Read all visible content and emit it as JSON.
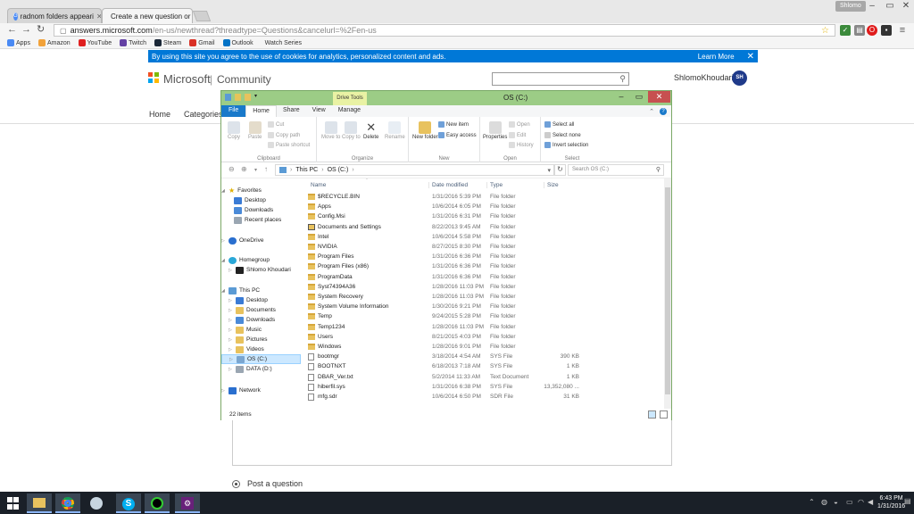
{
  "browser": {
    "tabs": [
      {
        "title": "radnom folders appeari",
        "active": false
      },
      {
        "title": "Create a new question or",
        "active": true
      }
    ],
    "profile": "Shlomo",
    "url_host": "answers.microsoft.com",
    "url_path": "/en-us/newthread?threadtype=Questions&cancelurl=%2Fen-us",
    "bookmarks": [
      "Apps",
      "Amazon",
      "YouTube",
      "Twitch",
      "Steam",
      "Gmail",
      "Outlook",
      "Watch Series"
    ]
  },
  "site": {
    "cookie_text": "By using this site you agree to the use of cookies for analytics, personalized content and ads.",
    "learn_more": "Learn More",
    "brand": "Microsoft",
    "separator": "|",
    "community": "Community",
    "user_name": "ShlomoKhoudari",
    "avatar_initials": "SH",
    "nav": [
      "Home",
      "Categories"
    ],
    "post_question": "Post a question"
  },
  "explorer": {
    "title": "OS (C:)",
    "context_tab": "Drive Tools",
    "tabs": [
      "File",
      "Home",
      "Share",
      "View",
      "Manage"
    ],
    "ribbon": {
      "clipboard": {
        "label": "Clipboard",
        "copy": "Copy",
        "paste": "Paste",
        "cut": "Cut",
        "copy_path": "Copy path",
        "paste_shortcut": "Paste shortcut"
      },
      "organize": {
        "label": "Organize",
        "move_to": "Move to",
        "copy_to": "Copy to",
        "delete": "Delete",
        "rename": "Rename"
      },
      "new": {
        "label": "New",
        "new_item": "New item",
        "easy_access": "Easy access",
        "new_folder": "New folder"
      },
      "open": {
        "label": "Open",
        "open": "Open",
        "edit": "Edit",
        "history": "History",
        "properties": "Properties"
      },
      "select": {
        "label": "Select",
        "all": "Select all",
        "none": "Select none",
        "invert": "Invert selection"
      }
    },
    "address": {
      "crumbs": [
        "This PC",
        "OS (C:)"
      ],
      "search_placeholder": "Search OS (C:)"
    },
    "nav": {
      "favorites": "Favorites",
      "desktop": "Desktop",
      "downloads": "Downloads",
      "recent": "Recent places",
      "onedrive": "OneDrive",
      "homegroup": "Homegroup",
      "hg_user": "Shlomo Khoudari",
      "thispc": "This PC",
      "pc_desktop": "Desktop",
      "pc_documents": "Documents",
      "pc_downloads": "Downloads",
      "pc_music": "Music",
      "pc_pictures": "Pictures",
      "pc_videos": "Videos",
      "pc_os": "OS (C:)",
      "pc_data": "DATA (D:)",
      "network": "Network"
    },
    "columns": {
      "name": "Name",
      "date": "Date modified",
      "type": "Type",
      "size": "Size"
    },
    "files": [
      {
        "name": "$RECYCLE.BIN",
        "date": "1/31/2016 5:39 PM",
        "type": "File folder",
        "size": "",
        "icon": "folder"
      },
      {
        "name": "Apps",
        "date": "10/6/2014 6:05 PM",
        "type": "File folder",
        "size": "",
        "icon": "folder"
      },
      {
        "name": "Config.Msi",
        "date": "1/31/2016 6:31 PM",
        "type": "File folder",
        "size": "",
        "icon": "folder"
      },
      {
        "name": "Documents and Settings",
        "date": "8/22/2013 9:45 AM",
        "type": "File folder",
        "size": "",
        "icon": "link"
      },
      {
        "name": "Intel",
        "date": "10/6/2014 5:58 PM",
        "type": "File folder",
        "size": "",
        "icon": "folder"
      },
      {
        "name": "NVIDIA",
        "date": "8/27/2015 8:30 PM",
        "type": "File folder",
        "size": "",
        "icon": "folder"
      },
      {
        "name": "Program Files",
        "date": "1/31/2016 6:36 PM",
        "type": "File folder",
        "size": "",
        "icon": "folder"
      },
      {
        "name": "Program Files (x86)",
        "date": "1/31/2016 6:36 PM",
        "type": "File folder",
        "size": "",
        "icon": "folder"
      },
      {
        "name": "ProgramData",
        "date": "1/31/2016 6:36 PM",
        "type": "File folder",
        "size": "",
        "icon": "folder"
      },
      {
        "name": "Syst74394A36",
        "date": "1/28/2016 11:03 PM",
        "type": "File folder",
        "size": "",
        "icon": "folder"
      },
      {
        "name": "System Recovery",
        "date": "1/28/2016 11:03 PM",
        "type": "File folder",
        "size": "",
        "icon": "folder"
      },
      {
        "name": "System Volume Information",
        "date": "1/30/2016 9:21 PM",
        "type": "File folder",
        "size": "",
        "icon": "folder"
      },
      {
        "name": "Temp",
        "date": "9/24/2015 5:28 PM",
        "type": "File folder",
        "size": "",
        "icon": "folder"
      },
      {
        "name": "Temp1234",
        "date": "1/28/2016 11:03 PM",
        "type": "File folder",
        "size": "",
        "icon": "folder"
      },
      {
        "name": "Users",
        "date": "8/21/2015 4:03 PM",
        "type": "File folder",
        "size": "",
        "icon": "folder"
      },
      {
        "name": "Windows",
        "date": "1/28/2016 9:01 PM",
        "type": "File folder",
        "size": "",
        "icon": "folder"
      },
      {
        "name": "bootmgr",
        "date": "3/18/2014 4:54 AM",
        "type": "SYS File",
        "size": "390 KB",
        "icon": "file"
      },
      {
        "name": "BOOTNXT",
        "date": "6/18/2013 7:18 AM",
        "type": "SYS File",
        "size": "1 KB",
        "icon": "file"
      },
      {
        "name": "DBAR_Ver.txt",
        "date": "5/2/2014 11:33 AM",
        "type": "Text Document",
        "size": "1 KB",
        "icon": "file"
      },
      {
        "name": "hiberfil.sys",
        "date": "1/31/2016 6:38 PM",
        "type": "SYS File",
        "size": "13,352,080 ...",
        "icon": "file"
      },
      {
        "name": "mfg.sdr",
        "date": "10/6/2014 6:50 PM",
        "type": "SDR File",
        "size": "31 KB",
        "icon": "file"
      }
    ],
    "status": "22 items"
  },
  "taskbar": {
    "time": "6:43 PM",
    "date": "1/31/2016"
  },
  "colors": {
    "explorer_frame": "#9ccc86",
    "banner": "#0078d7",
    "file_tab": "#1979ca",
    "close_button": "#c75050",
    "taskbar": "#1a2028"
  }
}
